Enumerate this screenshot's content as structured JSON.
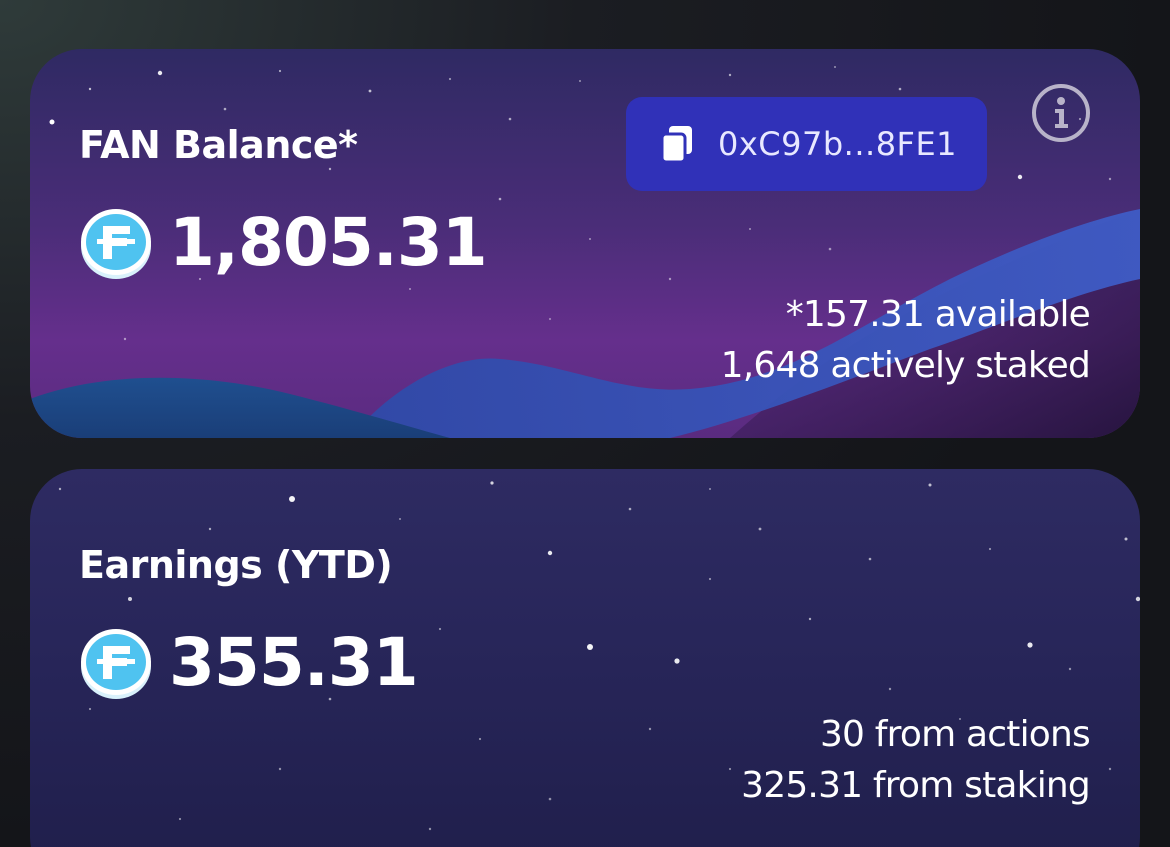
{
  "balance_card": {
    "title": "FAN Balance*",
    "amount": "1,805.31",
    "address": "0xC97b...8FE1",
    "available": "*157.31 available",
    "staked": "1,648 actively staked",
    "icons": {
      "token": "fan-token-icon",
      "copy": "copy-icon",
      "info": "info-icon"
    }
  },
  "earnings_card": {
    "title": "Earnings (YTD)",
    "amount": "355.31",
    "from_actions": "30 from actions",
    "from_staking": "325.31 from staking",
    "icons": {
      "token": "fan-token-icon"
    }
  },
  "colors": {
    "address_button": "#3031b8",
    "token_blue": "#4fc3f0",
    "card_purple": "#4a2d78",
    "card_navy": "#28265a"
  }
}
